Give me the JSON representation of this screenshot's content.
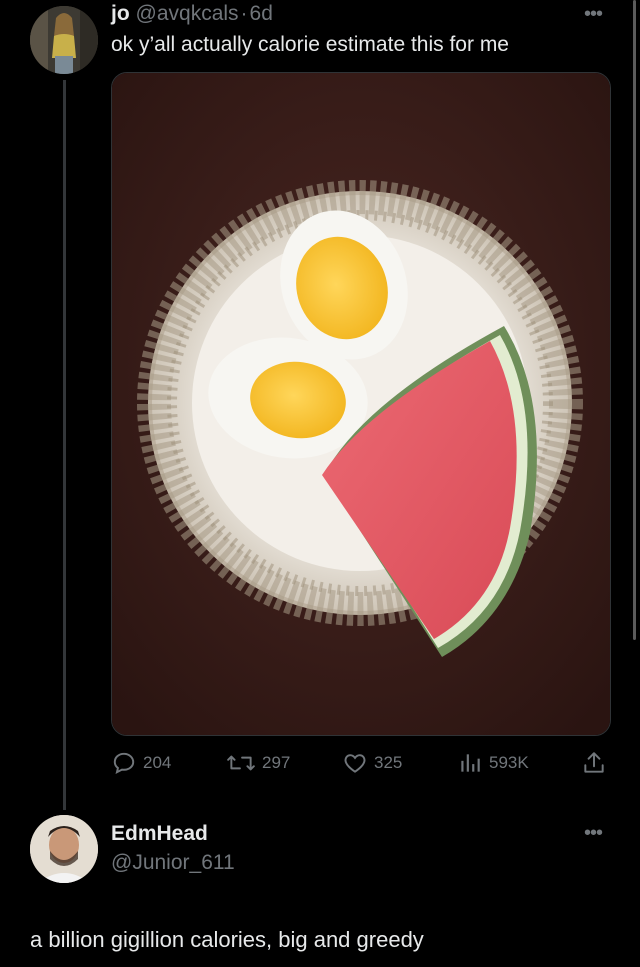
{
  "tweet": {
    "display_name": "jo",
    "handle": "@avqkcals",
    "separator": "·",
    "time": "6d",
    "text": "ok y’all actually calorie estimate this for me",
    "more_icon": "more-dots-icon",
    "stats": {
      "replies": "204",
      "retweets": "297",
      "likes": "325",
      "views": "593K"
    }
  },
  "reply": {
    "display_name": "EdmHead",
    "handle": "@Junior_611",
    "text": "a billion gigillion calories, big and greedy",
    "more_icon": "more-dots-icon"
  },
  "icons": {
    "reply": "reply-bubble-icon",
    "retweet": "retweet-icon",
    "like": "heart-icon",
    "views": "analytics-bars-icon",
    "share": "share-upload-icon"
  },
  "colors": {
    "background": "#000000",
    "text": "#e7e9ea",
    "muted": "#71767b"
  }
}
